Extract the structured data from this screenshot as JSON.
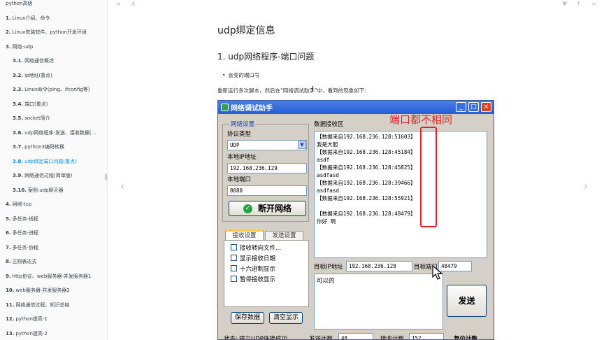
{
  "sidebar": {
    "items": [
      {
        "num": "",
        "label": "python高级",
        "level": 1,
        "active": false
      },
      {
        "num": "1.",
        "label": "Linux介绍、命令",
        "level": 1,
        "active": false
      },
      {
        "num": "2.",
        "label": "Linux安装软件、python开发环境",
        "level": 1,
        "active": false
      },
      {
        "num": "3.",
        "label": "网络-udp",
        "level": 1,
        "active": false
      },
      {
        "num": "3.1.",
        "label": "网络通信概述",
        "level": 2,
        "active": false
      },
      {
        "num": "3.2.",
        "label": "ip地址(重点)",
        "level": 2,
        "active": false
      },
      {
        "num": "3.3.",
        "label": "Linux命令(ping、ifconfig等)",
        "level": 2,
        "active": false
      },
      {
        "num": "3.4.",
        "label": "端口(重点)",
        "level": 2,
        "active": false
      },
      {
        "num": "3.5.",
        "label": "socket简介",
        "level": 2,
        "active": false
      },
      {
        "num": "3.6.",
        "label": "udp网络程序-发送、接收数据(...",
        "level": 2,
        "active": false
      },
      {
        "num": "3.7.",
        "label": "python3编码转换",
        "level": 2,
        "active": false
      },
      {
        "num": "3.8.",
        "label": "udp绑定端口问题(重点)",
        "level": 2,
        "active": true
      },
      {
        "num": "3.9.",
        "label": "网络通信过程(简单版)",
        "level": 2,
        "active": false
      },
      {
        "num": "3.10.",
        "label": "案例:udp聊天器",
        "level": 2,
        "active": false
      },
      {
        "num": "4.",
        "label": "网络-tcp",
        "level": 1,
        "active": false
      },
      {
        "num": "5.",
        "label": "多任务-线程",
        "level": 1,
        "active": false
      },
      {
        "num": "6.",
        "label": "多任务-进程",
        "level": 1,
        "active": false
      },
      {
        "num": "7.",
        "label": "多任务-协程",
        "level": 1,
        "active": false
      },
      {
        "num": "8.",
        "label": "正则表达式",
        "level": 1,
        "active": false
      },
      {
        "num": "9.",
        "label": "http协议、web服务器-并发服务器1",
        "level": 1,
        "active": false
      },
      {
        "num": "10.",
        "label": "web服务器-并发服务器2",
        "level": 1,
        "active": false
      },
      {
        "num": "11.",
        "label": "网络通信过程、知识总结",
        "level": 1,
        "active": false
      },
      {
        "num": "12.",
        "label": "python提高-1",
        "level": 1,
        "active": false
      },
      {
        "num": "13.",
        "label": "python提高-2",
        "level": 1,
        "active": false
      }
    ]
  },
  "toolbar": {
    "menu_icon": "≡",
    "font_icon": "A",
    "share_icons": [
      "twitter-icon",
      "facebook-icon",
      "share-icon"
    ],
    "share_glyphs": [
      "♥",
      "f",
      "⋖"
    ]
  },
  "nav": {
    "prev": "‹",
    "next": "›"
  },
  "content": {
    "title": "udp绑定信息",
    "section_heading": "1. udp网络程序-端口问题",
    "bullet": "会变的端口号",
    "paragraph": "重新运行多次脚本，然后在“网络调试助手”中，看到的现象如下："
  },
  "app_window": {
    "title": "网络调试助手",
    "controls": [
      "_",
      "□",
      "×"
    ],
    "net_settings": {
      "group_title": "网络设置",
      "protocol_label": "协议类型",
      "protocol_value": "UDP",
      "local_ip_label": "本地IP地址",
      "local_ip_value": "192.168.236.129",
      "local_port_label": "本地端口",
      "local_port_value": "8080",
      "disconnect_button": "断开网络"
    },
    "tabs": [
      "接收设置",
      "发送设置"
    ],
    "recv_options": [
      "接收转向文件...",
      "显示接收日期",
      "十六进制显示",
      "暂停接收显示"
    ],
    "save_button": "保存数据",
    "clear_button": "清空显示",
    "recv_area_title": "数据接收区",
    "recv_lines": [
      "【数据来自192.168.236.128:51603】",
      "我是大胆",
      "【数据来自192.168.236.128:45184】",
      "asdf",
      "【数据来自192.168.236.128:45825】",
      "asdfasd",
      "【数据来自192.168.236.128:39466】",
      "asdfasd",
      "【数据来自192.168.236.128:55921】",
      "",
      "【数据来自192.168.236.128:48479】",
      "你好 啊"
    ],
    "annotation": "端口都不相同",
    "target_ip_label": "目标IP地址",
    "target_ip_value": "192.168.236.128",
    "target_port_label": "目标端口",
    "target_port_value": "48479",
    "send_text": "可以的",
    "send_button": "发送",
    "status_label": "状态:",
    "status_text": "建立UDP连接成功",
    "send_count_label": "发送计数",
    "send_count_value": "48",
    "recv_count_label": "接收计数",
    "recv_count_value": "152",
    "reset_label": "复位计数"
  },
  "colors": {
    "accent": "#008cff",
    "annotation": "#e5202a",
    "titlebar": "#245ed8"
  }
}
